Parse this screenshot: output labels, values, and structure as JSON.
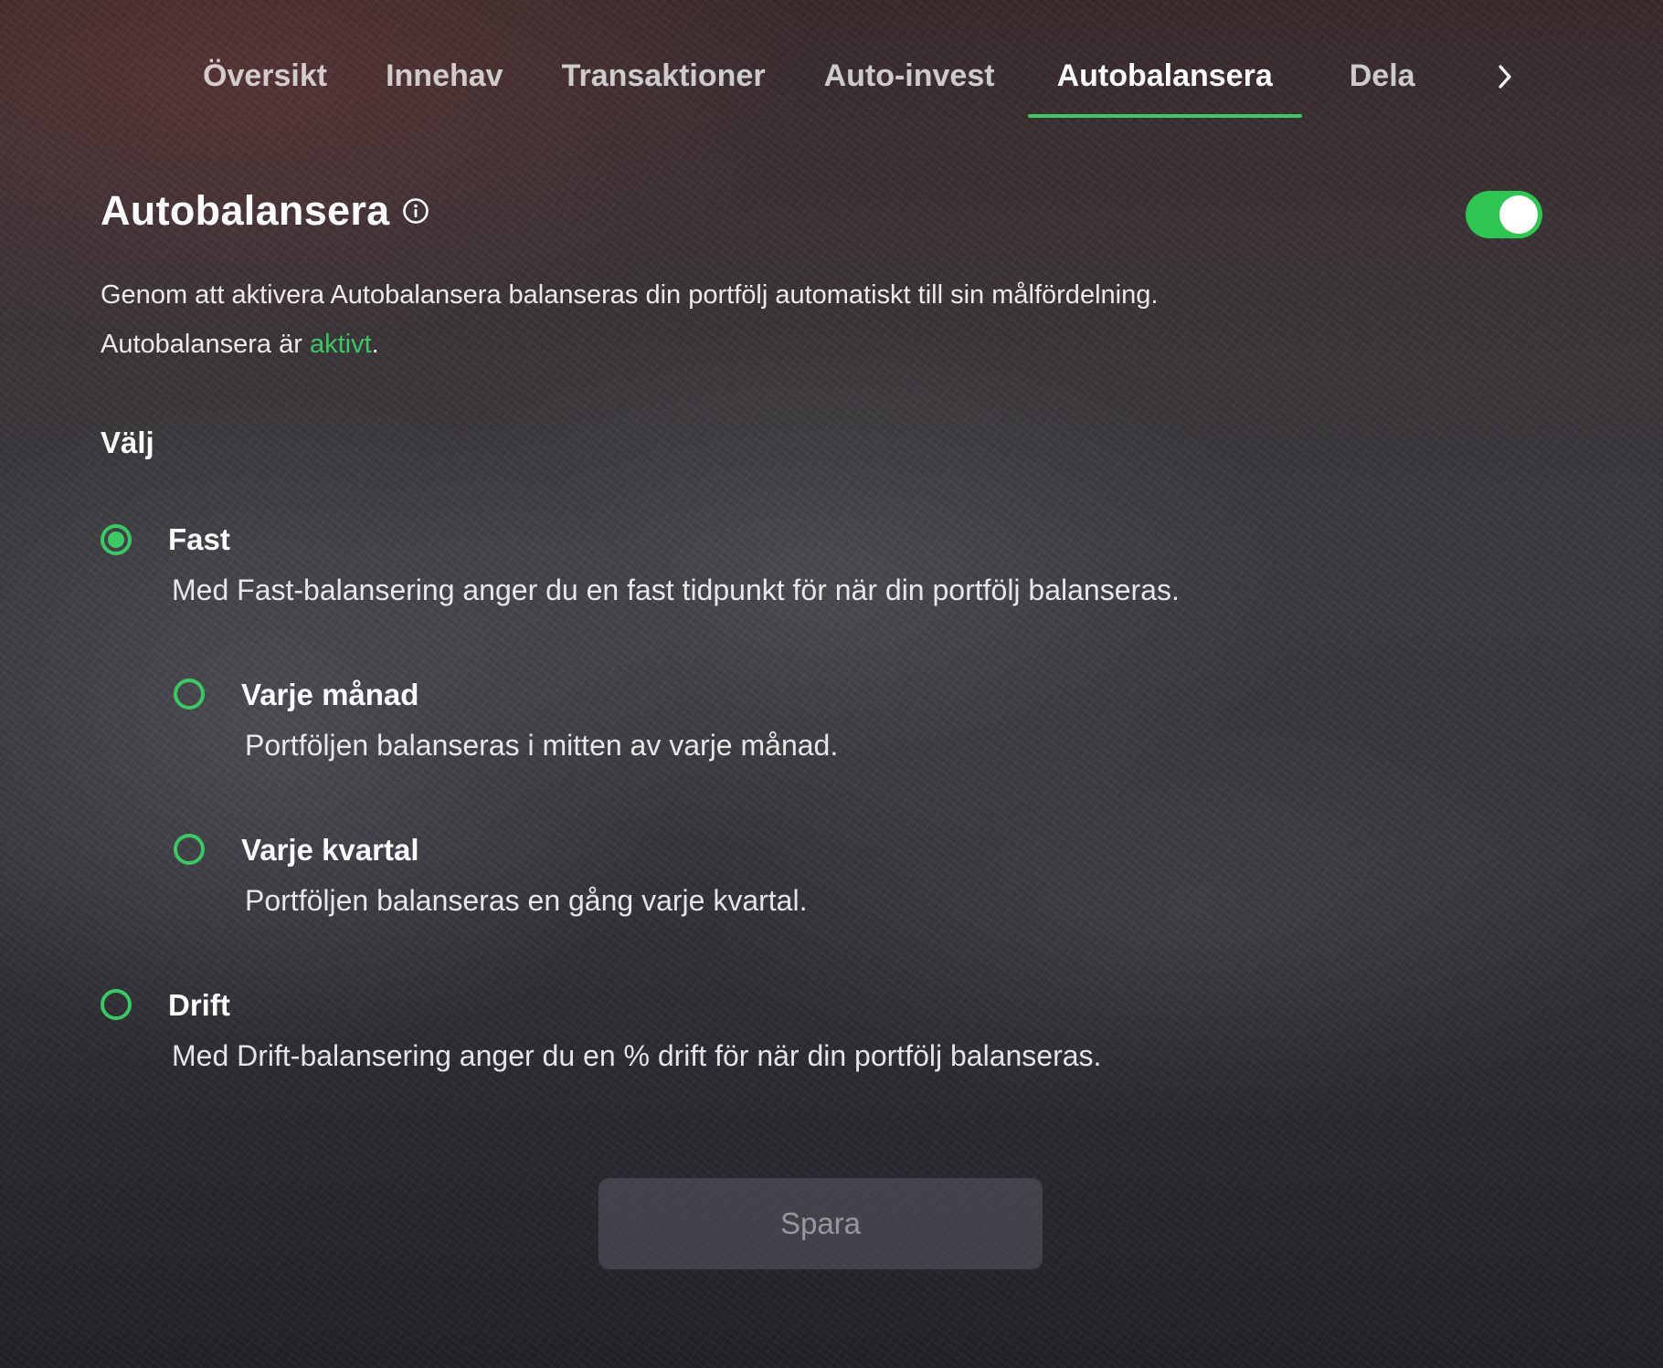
{
  "tabs": [
    {
      "label": "Översikt",
      "active": false
    },
    {
      "label": "Innehav",
      "active": false
    },
    {
      "label": "Transaktioner",
      "active": false
    },
    {
      "label": "Auto-invest",
      "active": false
    },
    {
      "label": "Autobalansera",
      "active": true
    },
    {
      "label": "Dela",
      "active": false
    }
  ],
  "tabs_more_icon": "chevron-right-icon",
  "header": {
    "title": "Autobalansera",
    "info_icon": "info-icon",
    "toggle_on": true
  },
  "description": {
    "line1": "Genom att aktivera Autobalansera balanseras din portfölj automatiskt till sin målfördelning.",
    "status_prefix": "Autobalansera är ",
    "status_link": "aktivt",
    "status_suffix": "."
  },
  "section_label": "Välj",
  "options": {
    "fast": {
      "label": "Fast",
      "description": "Med Fast-balansering anger du en fast tidpunkt för när din portfölj balanseras.",
      "selected": true
    },
    "monthly": {
      "label": "Varje månad",
      "description": "Portföljen balanseras i mitten av varje månad.",
      "selected": false
    },
    "quarterly": {
      "label": "Varje kvartal",
      "description": "Portföljen balanseras en gång varje kvartal.",
      "selected": false
    },
    "drift": {
      "label": "Drift",
      "description": "Med Drift-balansering anger du en % drift för när din portfölj balanseras.",
      "selected": false
    }
  },
  "save_button": {
    "label": "Spara",
    "disabled": true
  },
  "colors": {
    "accent": "#3cc864",
    "toggle": "#2fc552"
  }
}
